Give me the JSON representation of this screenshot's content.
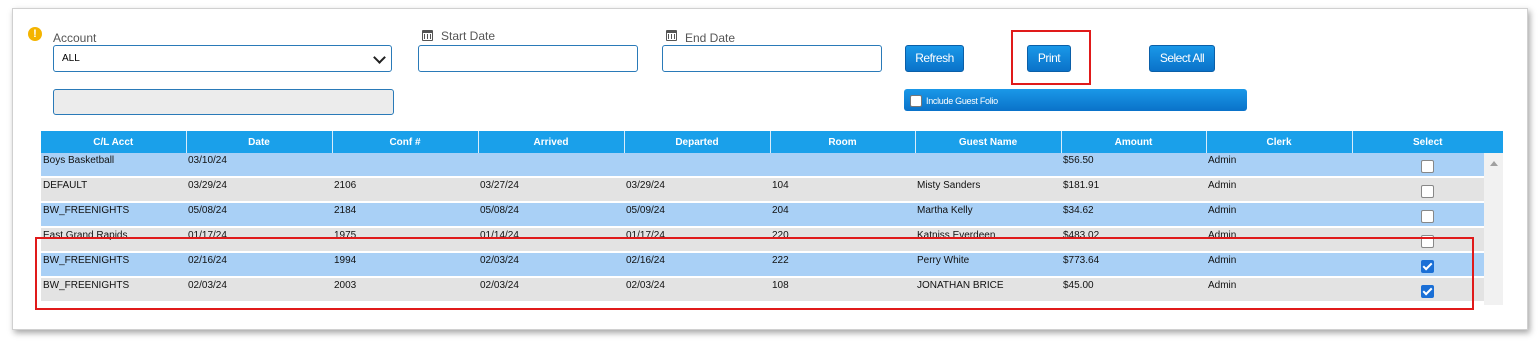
{
  "filters": {
    "account_label": "Account",
    "account_value": "ALL",
    "start_date_label": "Start Date",
    "start_date_value": "",
    "end_date_label": "End Date",
    "end_date_value": "",
    "extra_field_value": ""
  },
  "buttons": {
    "refresh": "Refresh",
    "print": "Print",
    "select_all": "Select All"
  },
  "include_guest_folio": {
    "label": "Include Guest Folio",
    "checked": false
  },
  "table": {
    "columns": [
      "C/L Acct",
      "Date",
      "Conf #",
      "Arrived",
      "Departed",
      "Room",
      "Guest Name",
      "Amount",
      "Clerk",
      "Select"
    ],
    "rows": [
      {
        "cl_acct": "Boys Basketball",
        "date": "03/10/24",
        "conf": "",
        "arrived": "",
        "departed": "",
        "room": "",
        "guest": "",
        "amount": "$56.50",
        "clerk": "Admin",
        "selected": false
      },
      {
        "cl_acct": "DEFAULT",
        "date": "03/29/24",
        "conf": "2106",
        "arrived": "03/27/24",
        "departed": "03/29/24",
        "room": "104",
        "guest": "Misty Sanders",
        "amount": "$181.91",
        "clerk": "Admin",
        "selected": false
      },
      {
        "cl_acct": "BW_FREENIGHTS",
        "date": "05/08/24",
        "conf": "2184",
        "arrived": "05/08/24",
        "departed": "05/09/24",
        "room": "204",
        "guest": "Martha Kelly",
        "amount": "$34.62",
        "clerk": "Admin",
        "selected": false
      },
      {
        "cl_acct": "East Grand Rapids",
        "date": "01/17/24",
        "conf": "1975",
        "arrived": "01/14/24",
        "departed": "01/17/24",
        "room": "220",
        "guest": "Katniss Everdeen",
        "amount": "$483.02",
        "clerk": "Admin",
        "selected": false
      },
      {
        "cl_acct": "BW_FREENIGHTS",
        "date": "02/16/24",
        "conf": "1994",
        "arrived": "02/03/24",
        "departed": "02/16/24",
        "room": "222",
        "guest": "Perry White",
        "amount": "$773.64",
        "clerk": "Admin",
        "selected": true
      },
      {
        "cl_acct": "BW_FREENIGHTS",
        "date": "02/03/24",
        "conf": "2003",
        "arrived": "02/03/24",
        "departed": "02/03/24",
        "room": "108",
        "guest": "JONATHAN BRICE",
        "amount": "$45.00",
        "clerk": "Admin",
        "selected": true
      }
    ]
  },
  "colors": {
    "accent": "#1aa0ea",
    "row_blue": "#a9d0f6",
    "row_gray": "#e3e3e3",
    "highlight_red": "#e01a1a"
  },
  "icons": [
    "info-icon",
    "calendar-icon",
    "chevron-down-icon",
    "checkbox-icon",
    "scroll-up-arrow-icon"
  ]
}
